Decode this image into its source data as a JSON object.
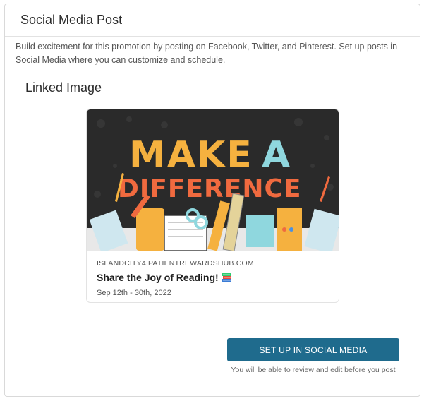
{
  "card": {
    "title": "Social Media Post",
    "description": "Build excitement for this promotion by posting on Facebook, Twitter, and Pinterest. Set up posts in Social Media where you can customize and schedule.",
    "section_title": "Linked Image"
  },
  "preview": {
    "image_text_line1": "MAKE A",
    "image_text_line2": "DIFFERENCE",
    "domain": "ISLANDCITY4.PATIENTREWARDSHUB.COM",
    "title": "Share the Joy of Reading!",
    "title_icon": "books-icon",
    "date": "Sep 12th - 30th, 2022"
  },
  "actions": {
    "setup_button": "SET UP IN SOCIAL MEDIA",
    "note": "You will be able to review and edit before you post"
  },
  "colors": {
    "button": "#1f6b8d",
    "image_bg": "#2b2b2b",
    "headline_yellow": "#f5b13f",
    "headline_cyan": "#8fd7de",
    "headline_orange": "#f06a3f"
  }
}
